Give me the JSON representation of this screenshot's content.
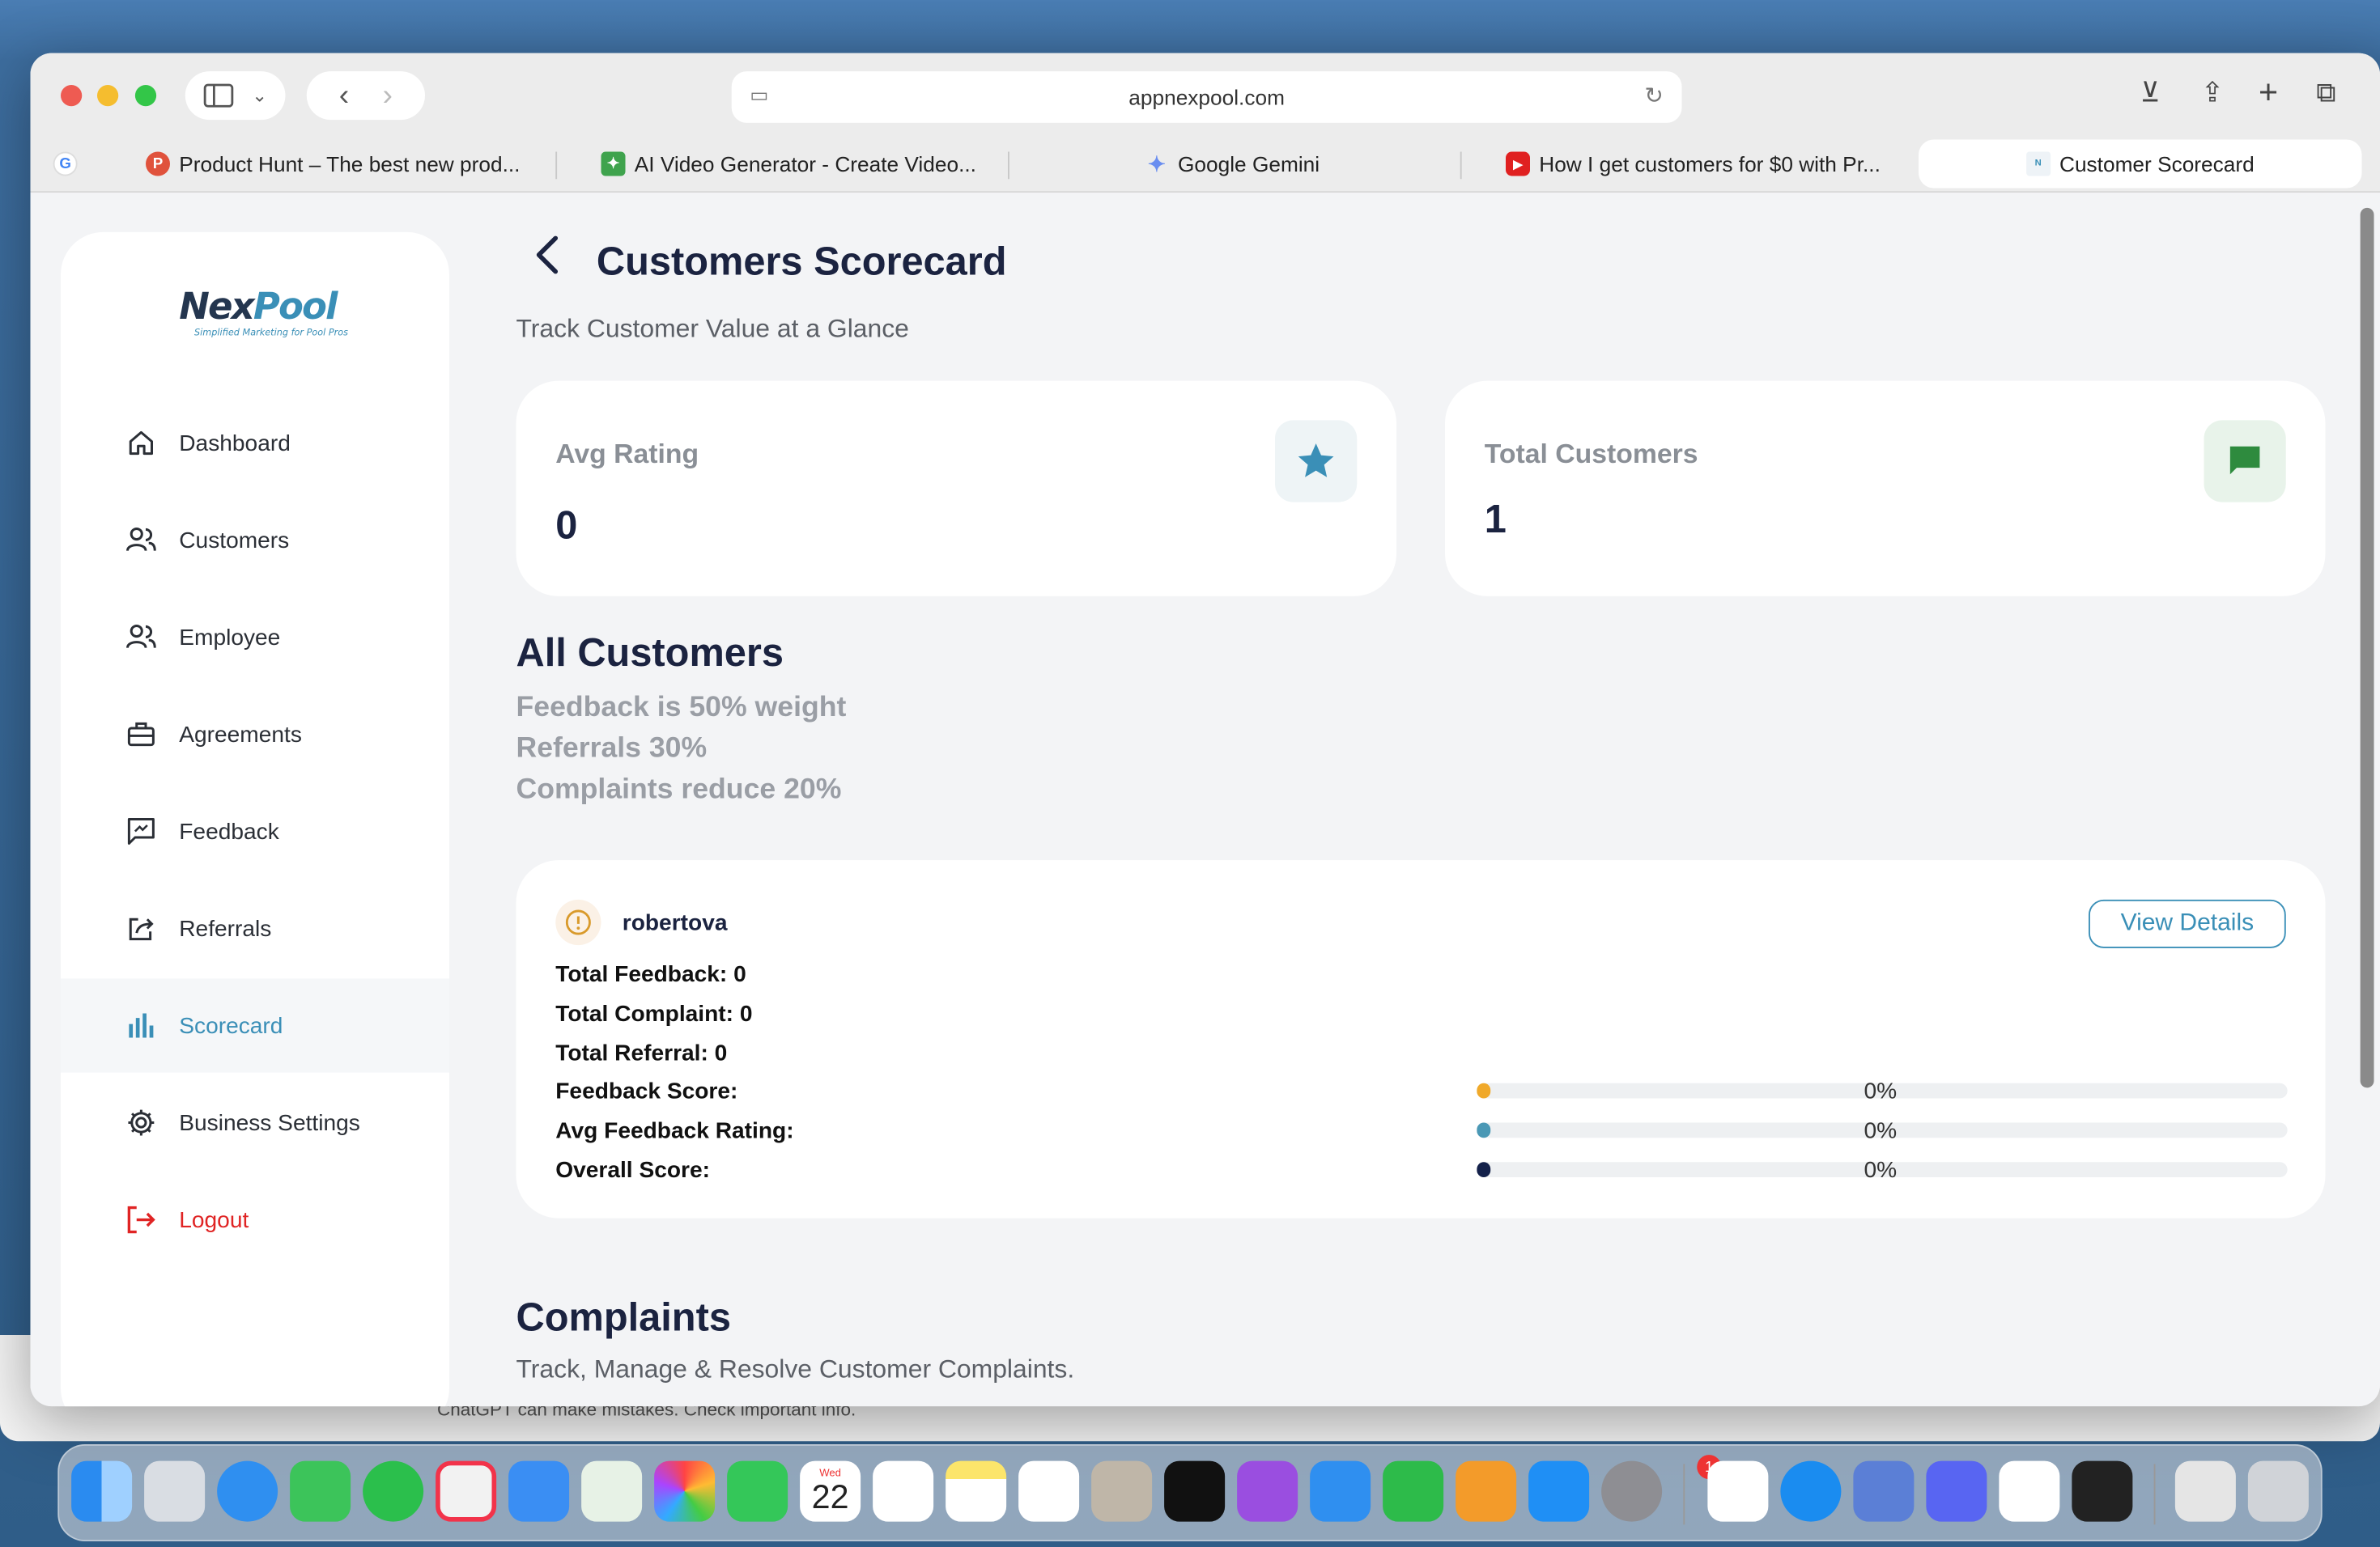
{
  "browser": {
    "url": "appnexpool.com",
    "tabs": [
      {
        "label": "Product Hunt – The best new prod...",
        "favicon_color": "#e0523c"
      },
      {
        "label": "AI Video Generator - Create Video...",
        "favicon_color": "#3fa34d"
      },
      {
        "label": "Google Gemini",
        "favicon_color": "#6a8ef0"
      },
      {
        "label": "How I get customers for $0 with Pr...",
        "favicon_color": "#e02020"
      },
      {
        "label": "Customer Scorecard",
        "favicon_color": "#3a8fb7"
      }
    ]
  },
  "sidebar": {
    "logo": {
      "part1": "Nex",
      "part2": "Pool",
      "tagline": "Simplified Marketing for Pool Pros"
    },
    "items": [
      {
        "label": "Dashboard",
        "icon": "home-icon"
      },
      {
        "label": "Customers",
        "icon": "users-icon"
      },
      {
        "label": "Employee",
        "icon": "users-icon"
      },
      {
        "label": "Agreements",
        "icon": "briefcase-icon"
      },
      {
        "label": "Feedback",
        "icon": "feedback-icon"
      },
      {
        "label": "Referrals",
        "icon": "share-icon"
      },
      {
        "label": "Scorecard",
        "icon": "bar-chart-icon",
        "selected": true
      },
      {
        "label": "Business Settings",
        "icon": "gear-icon"
      },
      {
        "label": "Logout",
        "icon": "logout-icon"
      }
    ]
  },
  "header": {
    "title": "Customers Scorecard",
    "subtitle": "Track Customer Value at a Glance"
  },
  "summary": {
    "avg_rating": {
      "label": "Avg Rating",
      "value": "0",
      "icon": "star-icon"
    },
    "total_customers": {
      "label": "Total Customers",
      "value": "1",
      "icon": "chat-icon"
    }
  },
  "all_customers": {
    "heading": "All Customers",
    "weights": [
      "Feedback is 50% weight",
      "Referrals 30%",
      "Complaints reduce 20%"
    ],
    "customer": {
      "name": "robertova",
      "view_details": "View Details",
      "stats": [
        "Total Feedback: 0",
        "Total Complaint: 0",
        "Total Referral: 0"
      ],
      "scores": [
        {
          "label": "Feedback Score:",
          "value": "0%",
          "fraction": 0,
          "color": "#f0a92a"
        },
        {
          "label": "Avg Feedback Rating:",
          "value": "0%",
          "fraction": 0,
          "color": "#4a98b5"
        },
        {
          "label": "Overall Score:",
          "value": "0%",
          "fraction": 0,
          "color": "#14214a"
        }
      ]
    }
  },
  "complaints": {
    "heading": "Complaints",
    "subtitle": "Track, Manage & Resolve Customer Complaints."
  },
  "background_window": {
    "note": "ChatGPT can make mistakes. Check important info."
  },
  "dock": {
    "calendar_day_label": "Wed",
    "calendar_date": "22",
    "settings_badge": "1"
  }
}
